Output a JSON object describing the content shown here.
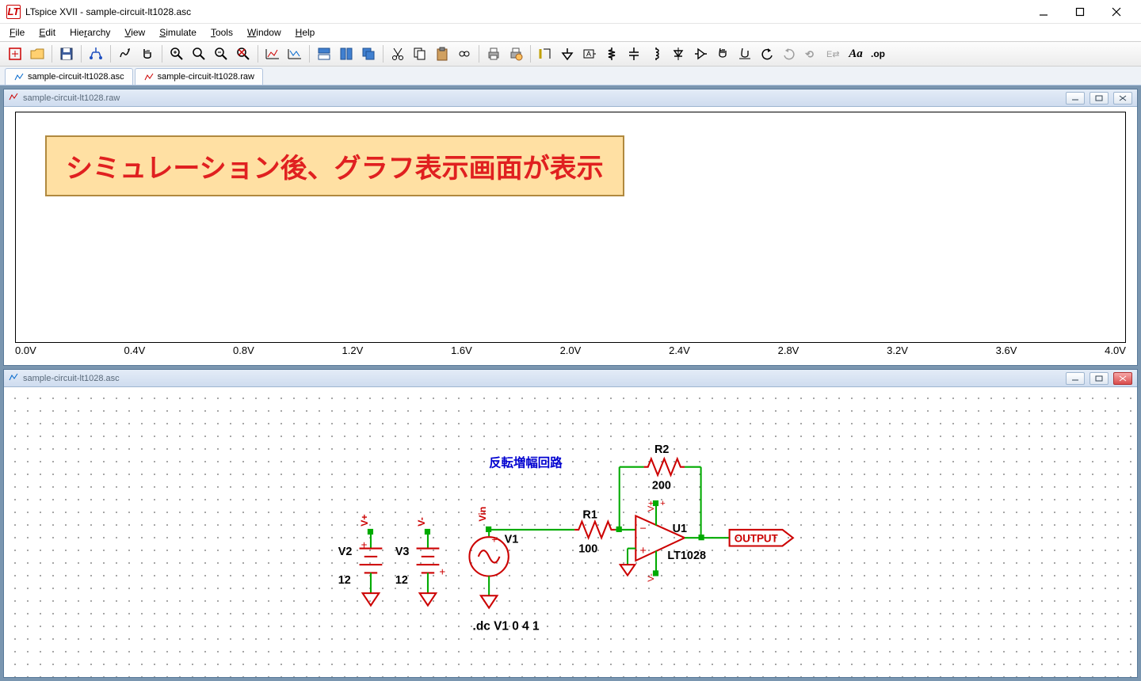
{
  "title": "LTspice XVII - sample-circuit-lt1028.asc",
  "menu": [
    "File",
    "Edit",
    "Hierarchy",
    "View",
    "Simulate",
    "Tools",
    "Window",
    "Help"
  ],
  "tabs": [
    {
      "label": "sample-circuit-lt1028.asc",
      "icon": "asc"
    },
    {
      "label": "sample-circuit-lt1028.raw",
      "icon": "raw"
    }
  ],
  "pane_raw_title": "sample-circuit-lt1028.raw",
  "pane_asc_title": "sample-circuit-lt1028.asc",
  "overlay_message": "シミュレーション後、グラフ表示画面が表示",
  "xaxis": [
    "0.0V",
    "0.4V",
    "0.8V",
    "1.2V",
    "1.6V",
    "2.0V",
    "2.4V",
    "2.8V",
    "3.2V",
    "3.6V",
    "4.0V"
  ],
  "circuit": {
    "title": "反転増幅回路",
    "v2": {
      "name": "V2",
      "value": "12",
      "pos": "V+"
    },
    "v3": {
      "name": "V3",
      "value": "12",
      "pos": "V-"
    },
    "v1": {
      "name": "V1",
      "label": "Vin"
    },
    "r1": {
      "name": "R1",
      "value": "100"
    },
    "r2": {
      "name": "R2",
      "value": "200"
    },
    "u1": {
      "name": "U1",
      "value": "LT1028",
      "vp": "V+",
      "vm": "V-"
    },
    "output": "OUTPUT",
    "directive": ".dc V1 0 4 1"
  }
}
